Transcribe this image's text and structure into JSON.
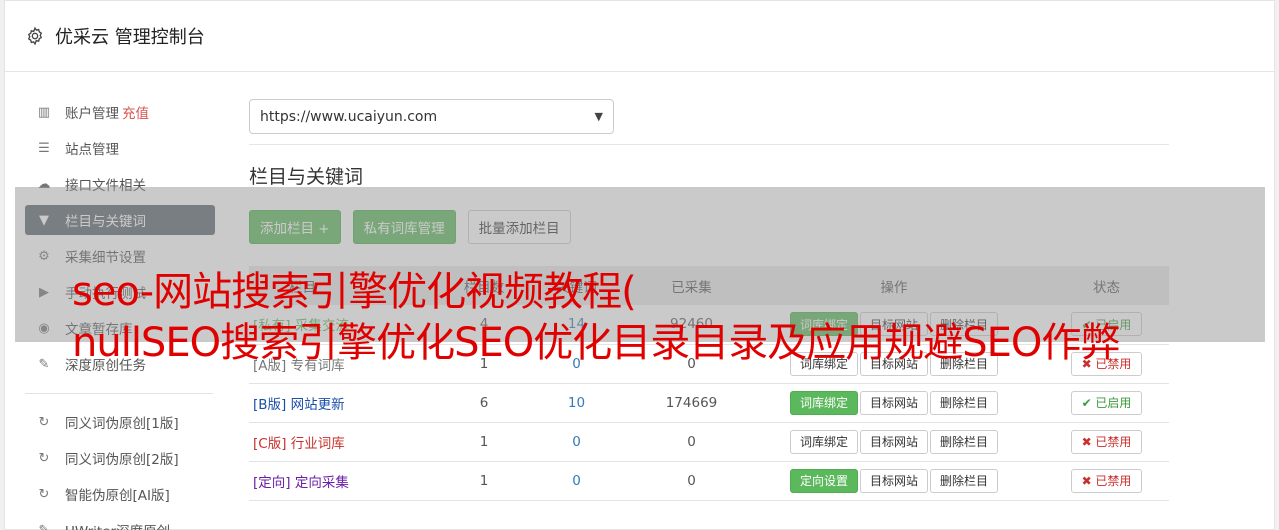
{
  "header": {
    "title": "优采云 管理控制台",
    "icon": "gear-icon"
  },
  "sidebar": {
    "items": [
      {
        "label": "账户管理",
        "extra": "充值",
        "icon": "bar-chart-icon"
      },
      {
        "label": "站点管理",
        "icon": "server-icon"
      },
      {
        "label": "接口文件相关",
        "icon": "cloud-upload-icon"
      },
      {
        "label": "栏目与关键词",
        "icon": "filter-icon",
        "active": true
      },
      {
        "label": "采集细节设置",
        "icon": "cogs-icon"
      },
      {
        "label": "手动执行测试",
        "icon": "play-circle-icon"
      },
      {
        "label": "文章暂存库",
        "icon": "database-icon"
      },
      {
        "label": "深度原创任务",
        "icon": "edit-icon"
      }
    ],
    "items2": [
      {
        "label": "同义词伪原创[1版]",
        "icon": "refresh-icon"
      },
      {
        "label": "同义词伪原创[2版]",
        "icon": "refresh-icon"
      },
      {
        "label": "智能伪原创[AI版]",
        "icon": "refresh-icon"
      },
      {
        "label": "UWriter深度原创",
        "icon": "edit-icon"
      }
    ]
  },
  "main": {
    "site_select": {
      "value": "https://www.ucaiyun.com"
    },
    "section_title": "栏目与关键词",
    "buttons": {
      "add_column": "添加栏目 +",
      "private_lib": "私有词库管理",
      "batch_add": "批量添加栏目"
    },
    "table": {
      "headers": [
        "栏目",
        "栏目数",
        "关键词",
        "已采集",
        "操作",
        "状态"
      ],
      "rows": [
        {
          "tag": "[私有]",
          "name": "采集交流",
          "c1": "4",
          "c2": "14",
          "c3": "92460",
          "bind_label": "词库绑定",
          "bind_green": true,
          "status": "✔ 已启用",
          "status_on": true,
          "tag_class": "tag-private"
        },
        {
          "tag": "[A版]",
          "name": "专有词库",
          "c1": "1",
          "c2": "0",
          "c3": "0",
          "bind_label": "词库绑定",
          "bind_green": false,
          "status": "✖ 已禁用",
          "status_on": false,
          "tag_class": "tag-a"
        },
        {
          "tag": "[B版]",
          "name": "网站更新",
          "c1": "6",
          "c2": "10",
          "c3": "174669",
          "bind_label": "词库绑定",
          "bind_green": true,
          "status": "✔ 已启用",
          "status_on": true,
          "tag_class": "tag-b"
        },
        {
          "tag": "[C版]",
          "name": "行业词库",
          "c1": "1",
          "c2": "0",
          "c3": "0",
          "bind_label": "词库绑定",
          "bind_green": false,
          "status": "✖ 已禁用",
          "status_on": false,
          "tag_class": "tag-c"
        },
        {
          "tag": "[定向]",
          "name": "定向采集",
          "c1": "1",
          "c2": "0",
          "c3": "0",
          "bind_label": "定向设置",
          "bind_green": true,
          "status": "✖ 已禁用",
          "status_on": false,
          "tag_class": "tag-dir"
        }
      ],
      "target_site": "目标网站",
      "delete_column": "删除栏目"
    }
  },
  "overlay": {
    "line1": "seo-网站搜索引擎优化视频教程(",
    "line2": "nullSEO搜索引擎优化SEO优化目录目录及应用规避SEO作弊"
  },
  "colors": {
    "accent_green": "#5cb85c",
    "sidebar_active": "#5c6670",
    "overlay_text": "#e00000"
  }
}
